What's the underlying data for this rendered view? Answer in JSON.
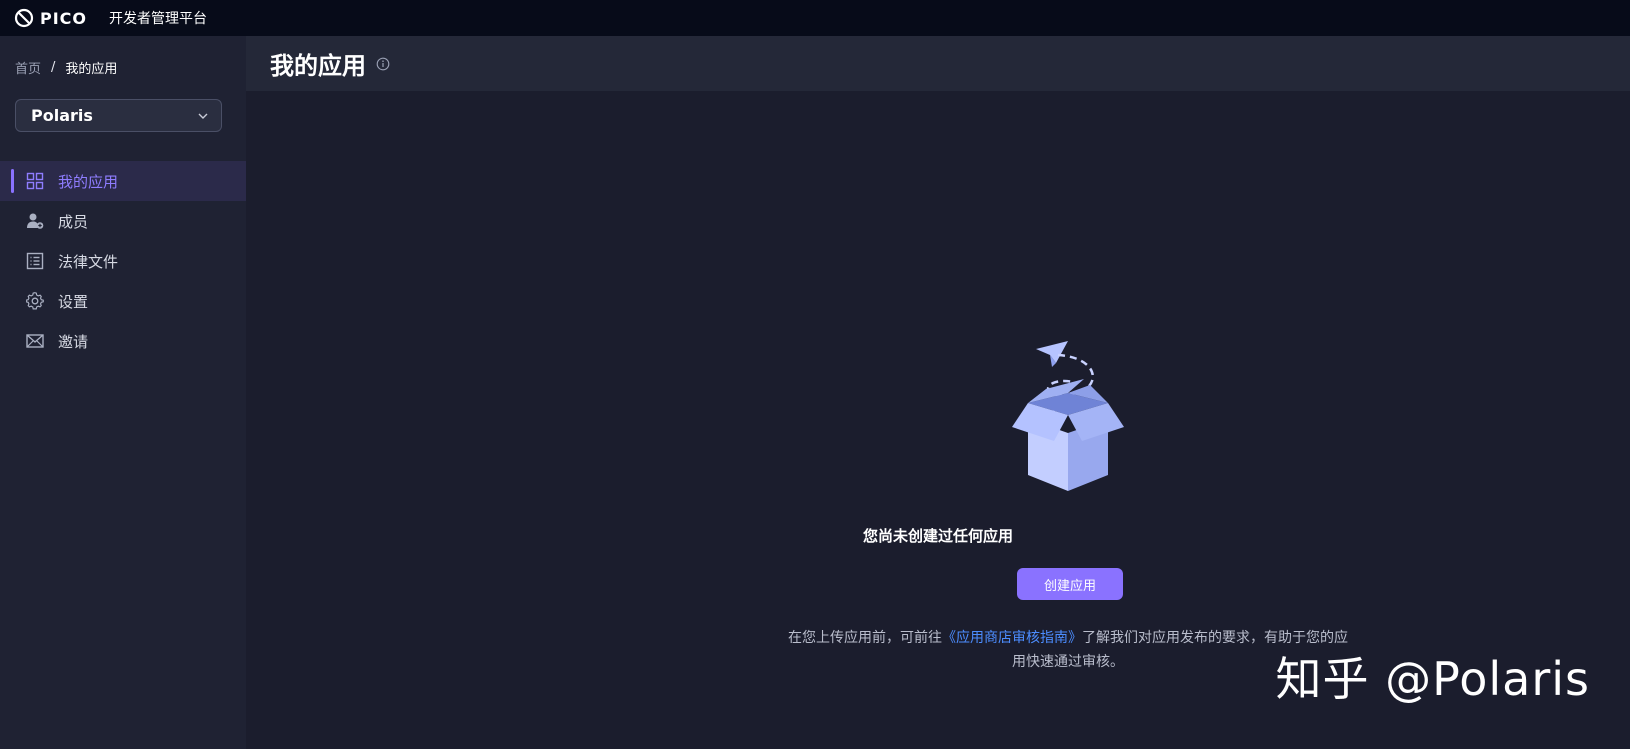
{
  "topbar": {
    "logo_text": "PICO",
    "platform_title": "开发者管理平台"
  },
  "sidebar": {
    "breadcrumb": {
      "home": "首页",
      "separator": "/",
      "current": "我的应用"
    },
    "app_select": {
      "value": "Polaris"
    },
    "items": [
      {
        "label": "我的应用",
        "icon": "grid-icon",
        "active": true
      },
      {
        "label": "成员",
        "icon": "member-icon",
        "active": false
      },
      {
        "label": "法律文件",
        "icon": "document-list-icon",
        "active": false
      },
      {
        "label": "设置",
        "icon": "gear-icon",
        "active": false
      },
      {
        "label": "邀请",
        "icon": "mail-icon",
        "active": false
      }
    ]
  },
  "main": {
    "title": "我的应用",
    "empty": {
      "title": "您尚未创建过任何应用",
      "button": "创建应用",
      "hint_before": "在您上传应用前，可前往",
      "hint_link": "《应用商店审核指南》",
      "hint_after": "了解我们对应用发布的要求，有助于您的应用快速通过审核。"
    }
  },
  "watermark": "知乎 @Polaris",
  "colors": {
    "accent": "#8a72ff",
    "link": "#4c8dff",
    "topbar_bg": "#070b19",
    "sidebar_bg": "#1f2233",
    "main_bg": "#1b1d2d"
  }
}
